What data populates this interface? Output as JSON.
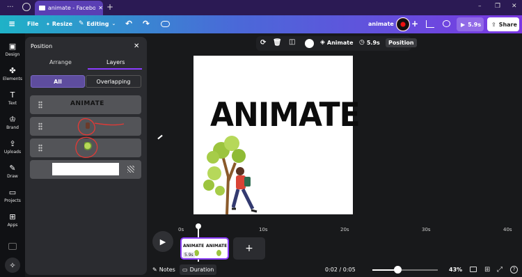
{
  "browser": {
    "tab_title": "animate - Faceboo...",
    "new_tab": "+",
    "window_controls": [
      "–",
      "❐",
      "✕"
    ]
  },
  "toolbar": {
    "menu": "≡",
    "file": "File",
    "resize": "Resize",
    "editing": "Editing",
    "design_name": "animate",
    "duration": "5.9s",
    "share": "Share"
  },
  "sidebar": {
    "items": [
      {
        "label": "Design",
        "icon": "design-icon"
      },
      {
        "label": "Elements",
        "icon": "elements-icon"
      },
      {
        "label": "Text",
        "icon": "text-icon"
      },
      {
        "label": "Brand",
        "icon": "brand-icon"
      },
      {
        "label": "Uploads",
        "icon": "uploads-icon"
      },
      {
        "label": "Draw",
        "icon": "draw-icon"
      },
      {
        "label": "Projects",
        "icon": "projects-icon"
      },
      {
        "label": "Apps",
        "icon": "apps-icon"
      }
    ]
  },
  "position_panel": {
    "title": "Position",
    "close": "✕",
    "tabs": [
      "Arrange",
      "Layers"
    ],
    "active_tab": "Layers",
    "filters": [
      "All",
      "Overlapping"
    ],
    "active_filter": "All",
    "layers": [
      {
        "type": "text",
        "preview": "ANIMATE"
      },
      {
        "type": "character",
        "preview": ""
      },
      {
        "type": "tree",
        "preview": ""
      },
      {
        "type": "background",
        "preview": ""
      }
    ]
  },
  "context_toolbar": {
    "animate": "Animate",
    "duration": "5.9s",
    "position": "Position"
  },
  "canvas": {
    "headline": "ANIMATE"
  },
  "timeline": {
    "ticks": [
      "0s",
      "10s",
      "20s",
      "30s",
      "40s"
    ],
    "clip_thumb_text": "ANIMATE",
    "clip_duration": "5.9s",
    "add_page": "+"
  },
  "footer": {
    "notes": "Notes",
    "duration": "Duration",
    "time": "0:02 / 0:05",
    "zoom": "43%",
    "zoom_level": 0.43
  },
  "colors": {
    "accent": "#8b3dff",
    "panel": "#2b2c30",
    "annotation": "#e53935"
  }
}
